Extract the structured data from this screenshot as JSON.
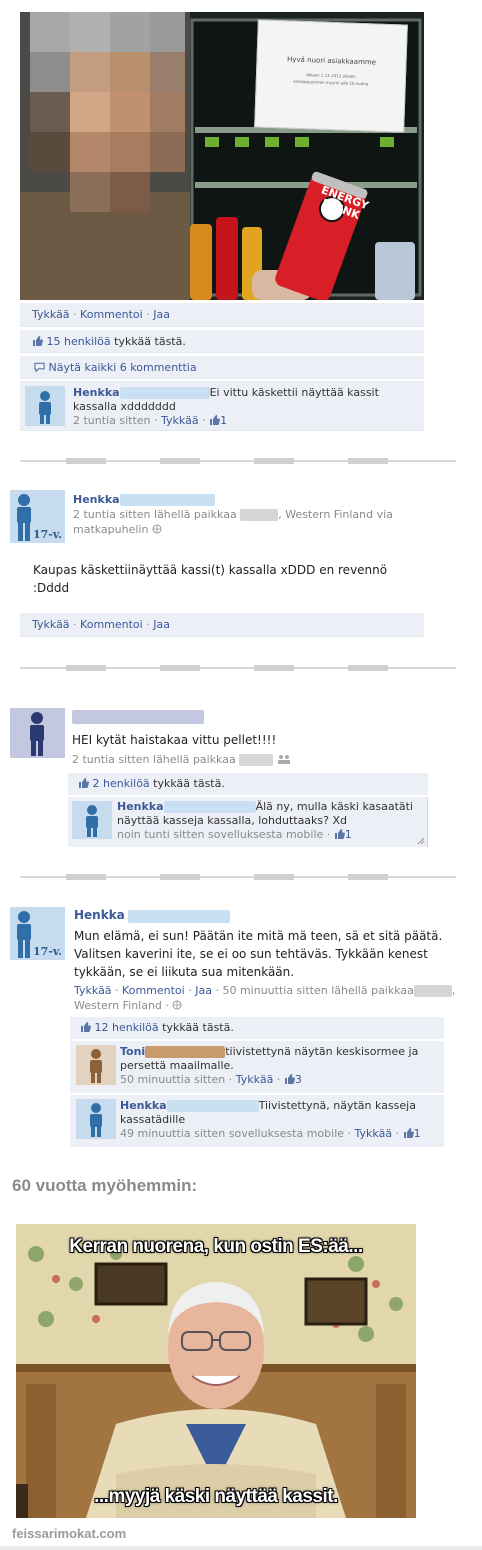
{
  "post1": {
    "sign_title": "Hyvä nuori asiakkaamme",
    "sign_line1": "Alkaen 1.11.2012 alkaen",
    "sign_line2": "energiajuomien myynti alle 15-vuotia",
    "can_text_1": "ENERGY",
    "can_text_2": "DRINK",
    "actions": {
      "like": "Tykkää",
      "comment": "Kommentoi",
      "share": "Jaa"
    },
    "likes_link": "15 henkilöä",
    "likes_rest": " tykkää tästä.",
    "view_comments": "Näytä kaikki 6 kommenttia",
    "comment": {
      "name": "Henkka",
      "text_first": "Ei vittu käskettii näyttää kassit",
      "text_second": "kassalla xddddddd",
      "time": "2 tuntia sitten",
      "like": "Tykkää",
      "like_count": "1"
    }
  },
  "post2": {
    "name": "Henkka",
    "age_badge": "17-v.",
    "meta_a": "2 tuntia sitten lähellä paikkaa",
    "meta_b": ", Western Finland via",
    "meta_c": "matkapuhelin",
    "text_line1": "Kaupas käskettiinäyttää kassi(t) kassalla xDDD en revennö",
    "text_line2": ":Dddd",
    "actions": {
      "like": "Tykkää",
      "comment": "Kommentoi",
      "share": "Jaa"
    }
  },
  "post3": {
    "text": "HEI kytät haistakaa vittu pellet!!!!",
    "meta": "2 tuntia sitten lähellä paikkaa",
    "likes_link": "2 henkilöä",
    "likes_rest": " tykkää tästä.",
    "comment": {
      "name": "Henkka",
      "text_first": "Älä ny, mulla käski kasaatäti",
      "text_second": "näyttää kasseja kassalla, lohduttaaks? Xd",
      "time": "noin tunti sitten sovelluksesta mobile",
      "like_count": "1"
    }
  },
  "post4": {
    "name": "Henkka",
    "age_badge": "17-v.",
    "text_line1": "Mun elämä, ei sun! Päätän ite mitä mä teen, sä et sitä päätä.",
    "text_line2": "Valitsen kaverini ite, se ei oo sun tehtäväs. Tykkään kenest",
    "text_line3": "tykkään, se ei liikuta sua mitenkään.",
    "actions": {
      "like": "Tykkää",
      "comment": "Kommentoi",
      "share": "Jaa"
    },
    "meta_a": "50 minuuttia sitten lähellä paikkaa",
    "meta_b": "Western Finland",
    "likes_link": "12 henkilöä",
    "likes_rest": " tykkää tästä.",
    "comment1": {
      "name": "Toni",
      "text_first": "tiivistettynä näytän keskisormee ja",
      "text_second": "persettä maailmalle.",
      "time": "50 minuuttia sitten",
      "like": "Tykkää",
      "like_count": "3"
    },
    "comment2": {
      "name": "Henkka",
      "text_first": "Tiivistettynä, näytän kasseja",
      "text_second": "kassatädille",
      "time": "49 minuuttia sitten sovelluksesta mobile",
      "like": "Tykkää",
      "like_count": "1"
    }
  },
  "heading": "60 vuotta myöhemmin:",
  "meme": {
    "top_text": "Kerran nuorena, kun ostin ES:ää...",
    "bottom_text": "...myyjä käski näyttää kassit."
  },
  "watermark": "feissarimokat.com",
  "colors": {
    "link": "#3b5998",
    "bar": "#eceff5",
    "redaction": "#c8e0f2"
  }
}
